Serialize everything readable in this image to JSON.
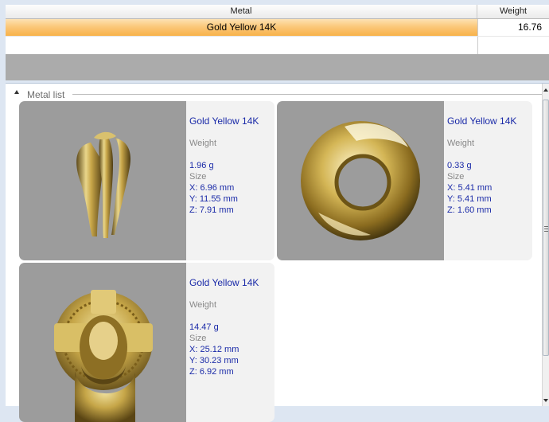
{
  "grid": {
    "columns": [
      "Metal",
      "Weight"
    ],
    "rows": [
      {
        "metal": "Gold Yellow 14K",
        "weight": "16.76"
      }
    ]
  },
  "metal_list": {
    "title": "Metal list",
    "cards": [
      {
        "model": "earring-drop-icon",
        "metal": "Gold Yellow 14K",
        "weight_label": "Weight",
        "weight": "1.96 g",
        "size_label": "Size",
        "x": "X: 6.96 mm",
        "y": "Y: 11.55 mm",
        "z": "Z: 7.91 mm"
      },
      {
        "model": "ring-torus-icon",
        "metal": "Gold Yellow 14K",
        "weight_label": "Weight",
        "weight": "0.33 g",
        "size_label": "Size",
        "x": "X: 5.41 mm",
        "y": "Y: 5.41 mm",
        "z": "Z: 1.60 mm"
      },
      {
        "model": "jesus-pendant-icon",
        "metal": "Gold Yellow 14K",
        "weight_label": "Weight",
        "weight": "14.47 g",
        "size_label": "Size",
        "x": "X: 25.12 mm",
        "y": "Y: 30.23 mm",
        "z": "Z: 6.92 mm"
      }
    ]
  },
  "colors": {
    "selection": "#fbc87a",
    "gold": "#c9ac4c",
    "thumb_bg": "#9c9c9c",
    "info_text": "#1a2aa8"
  }
}
